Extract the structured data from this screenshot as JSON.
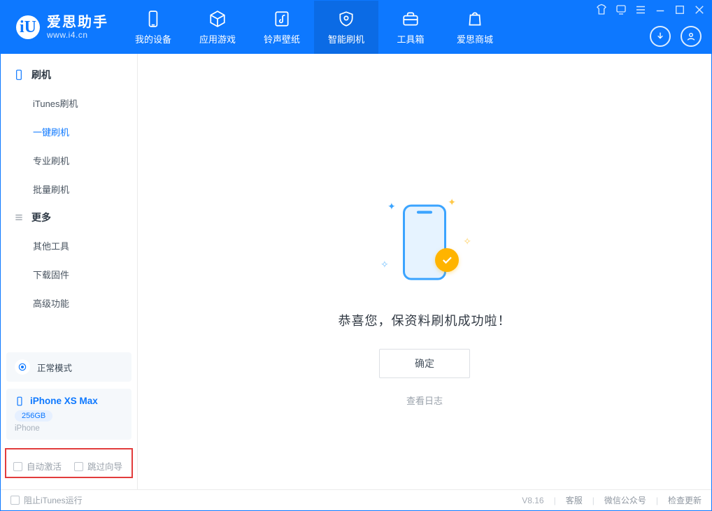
{
  "app": {
    "name": "爱思助手",
    "domain": "www.i4.cn",
    "logo_letter": "iU",
    "version": "V8.16"
  },
  "topnav": {
    "items": [
      {
        "label": "我的设备",
        "icon": "phone-icon"
      },
      {
        "label": "应用游戏",
        "icon": "cube-icon"
      },
      {
        "label": "铃声壁纸",
        "icon": "music-icon"
      },
      {
        "label": "智能刷机",
        "icon": "shield-icon",
        "active": true
      },
      {
        "label": "工具箱",
        "icon": "toolbox-icon"
      },
      {
        "label": "爱思商城",
        "icon": "bag-icon"
      }
    ]
  },
  "sidebar": {
    "group1": {
      "title": "刷机",
      "items": [
        {
          "label": "iTunes刷机"
        },
        {
          "label": "一键刷机",
          "active": true
        },
        {
          "label": "专业刷机"
        },
        {
          "label": "批量刷机"
        }
      ]
    },
    "group2": {
      "title": "更多",
      "items": [
        {
          "label": "其他工具"
        },
        {
          "label": "下载固件"
        },
        {
          "label": "高级功能"
        }
      ]
    },
    "device_mode": "正常模式",
    "device_name": "iPhone XS Max",
    "device_capacity": "256GB",
    "device_type": "iPhone",
    "options": {
      "auto_activate": "自动激活",
      "skip_guide": "跳过向导"
    }
  },
  "main": {
    "success_title": "恭喜您，保资料刷机成功啦！",
    "ok_label": "确定",
    "view_log_label": "查看日志"
  },
  "footer": {
    "block_itunes": "阻止iTunes运行",
    "links": {
      "support": "客服",
      "wechat": "微信公众号",
      "update": "检查更新"
    }
  }
}
